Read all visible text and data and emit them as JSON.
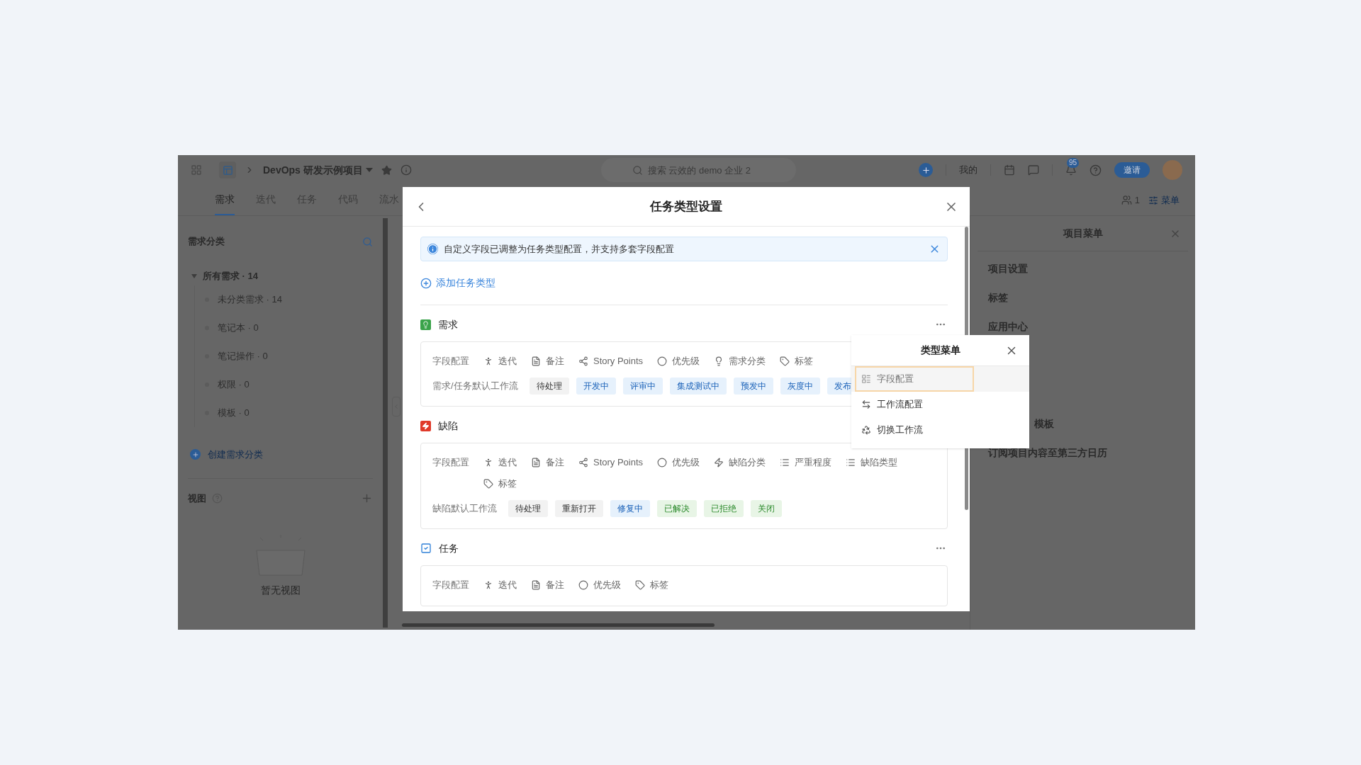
{
  "topbar": {
    "project": "DevOps 研发示例项目",
    "search": {
      "placeholder": "搜索 云效的 demo 企业 2"
    },
    "mine": "我的",
    "notification_badge": "95",
    "invite": "邀请"
  },
  "tabs": [
    {
      "label": "需求",
      "selected": true
    },
    {
      "label": "迭代",
      "selected": false
    },
    {
      "label": "任务",
      "selected": false
    },
    {
      "label": "代码",
      "selected": false
    },
    {
      "label": "流水",
      "selected": false
    }
  ],
  "tab_bar_right": {
    "members": "1",
    "menu": "菜单"
  },
  "sidebar": {
    "title": "需求分类",
    "tree": [
      {
        "label": "所有需求 · 14",
        "expanded": true,
        "children": [
          {
            "label": "未分类需求 · 14"
          },
          {
            "label": "笔记本 · 0"
          },
          {
            "label": "笔记操作 · 0"
          },
          {
            "label": "权限 · 0"
          },
          {
            "label": "模板 · 0"
          }
        ]
      }
    ],
    "create": "创建需求分类",
    "views_title": "视图",
    "empty": "暂无视图"
  },
  "project_menu": {
    "title": "项目菜单",
    "items": [
      "项目设置",
      "标签",
      "应用中心",
      "模板",
      "订阅项目内容至第三方日历"
    ]
  },
  "dialog": {
    "title": "任务类型设置",
    "alert": "自定义字段已调整为任务类型配置，并支持多套字段配置",
    "add": "添加任务类型",
    "types": [
      {
        "name": "需求",
        "kind": "requirement",
        "more": true,
        "field_label": "字段配置",
        "fields": [
          {
            "label": "迭代",
            "kind": "iteration"
          },
          {
            "label": "备注",
            "kind": "note"
          },
          {
            "label": "Story Points",
            "kind": "points"
          },
          {
            "label": "优先级",
            "kind": "priority"
          },
          {
            "label": "需求分类",
            "kind": "bulb"
          },
          {
            "label": "标签",
            "kind": "tag"
          }
        ],
        "workflow_label": "需求/任务默认工作流",
        "states": [
          {
            "label": "待处理",
            "kind": "todo"
          },
          {
            "label": "开发中",
            "kind": "doing"
          },
          {
            "label": "评审中",
            "kind": "doing"
          },
          {
            "label": "集成测试中",
            "kind": "doing"
          },
          {
            "label": "预发中",
            "kind": "doing"
          },
          {
            "label": "灰度中",
            "kind": "doing"
          },
          {
            "label": "发布",
            "kind": "doing"
          }
        ]
      },
      {
        "name": "缺陷",
        "kind": "bug",
        "more": false,
        "field_label": "字段配置",
        "fields": [
          {
            "label": "迭代",
            "kind": "iteration"
          },
          {
            "label": "备注",
            "kind": "note"
          },
          {
            "label": "Story Points",
            "kind": "points"
          },
          {
            "label": "优先级",
            "kind": "priority"
          },
          {
            "label": "缺陷分类",
            "kind": "lightning"
          },
          {
            "label": "严重程度",
            "kind": "list"
          },
          {
            "label": "缺陷类型",
            "kind": "list"
          },
          {
            "label": "标签",
            "kind": "tag"
          }
        ],
        "workflow_label": "缺陷默认工作流",
        "states": [
          {
            "label": "待处理",
            "kind": "todo"
          },
          {
            "label": "重新打开",
            "kind": "todo"
          },
          {
            "label": "修复中",
            "kind": "doing"
          },
          {
            "label": "已解决",
            "kind": "done"
          },
          {
            "label": "已拒绝",
            "kind": "done"
          },
          {
            "label": "关闭",
            "kind": "done"
          }
        ]
      },
      {
        "name": "任务",
        "kind": "task",
        "more": true,
        "field_label": "字段配置",
        "fields": [
          {
            "label": "迭代",
            "kind": "iteration"
          },
          {
            "label": "备注",
            "kind": "note"
          },
          {
            "label": "优先级",
            "kind": "priority"
          },
          {
            "label": "标签",
            "kind": "tag"
          }
        ]
      }
    ]
  },
  "type_menu": {
    "title": "类型菜单",
    "items": [
      {
        "label": "字段配置",
        "kind": "fields",
        "selected": true
      },
      {
        "label": "工作流配置",
        "kind": "workflow",
        "selected": false
      },
      {
        "label": "切换工作流",
        "kind": "switch",
        "selected": false
      }
    ]
  }
}
